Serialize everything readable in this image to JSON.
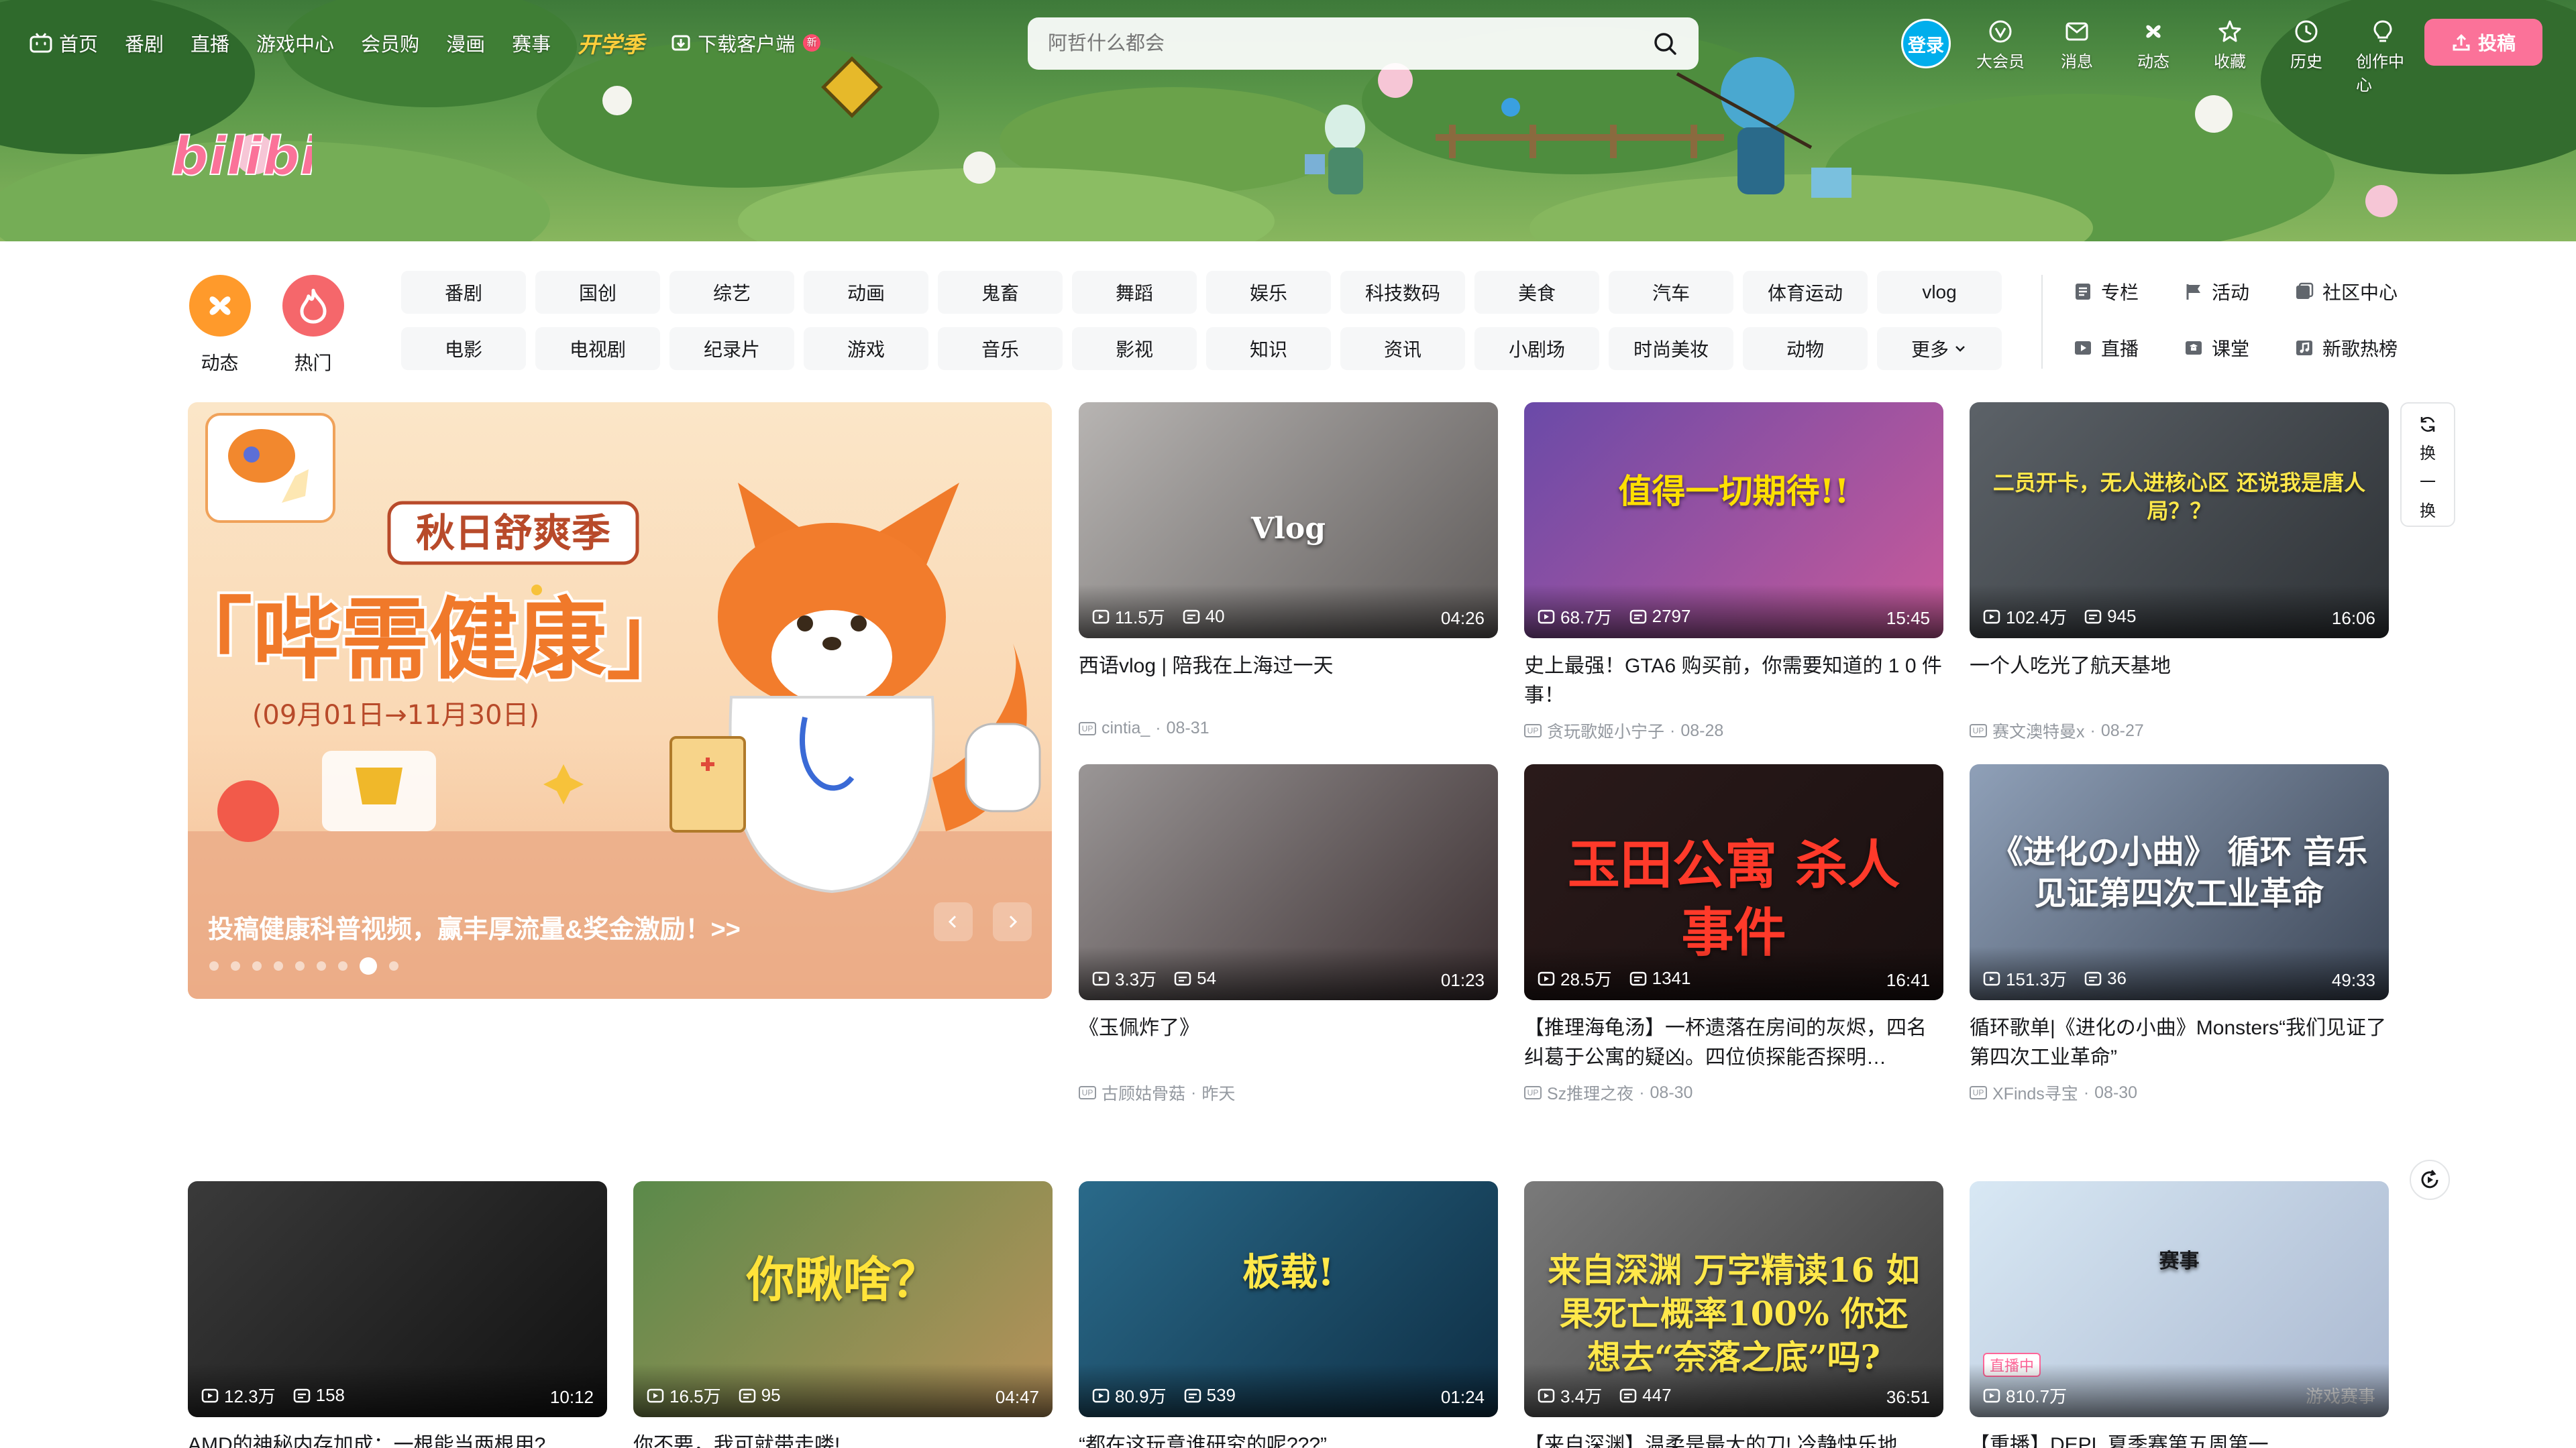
{
  "nav": {
    "left": [
      {
        "label": "首页",
        "icon": "tv-icon"
      },
      {
        "label": "番剧"
      },
      {
        "label": "直播"
      },
      {
        "label": "游戏中心"
      },
      {
        "label": "会员购"
      },
      {
        "label": "漫画"
      },
      {
        "label": "赛事"
      },
      {
        "label": "开学季",
        "special": true
      },
      {
        "label": "下载客户端",
        "icon": "download-icon",
        "badge": "新"
      }
    ],
    "search_placeholder": "阿哲什么都会",
    "login_label": "登录",
    "right": [
      {
        "label": "大会员",
        "icon": "vip-icon"
      },
      {
        "label": "消息",
        "icon": "message-icon"
      },
      {
        "label": "动态",
        "icon": "feed-icon"
      },
      {
        "label": "收藏",
        "icon": "star-icon"
      },
      {
        "label": "历史",
        "icon": "history-icon"
      },
      {
        "label": "创作中心",
        "icon": "bulb-icon"
      }
    ],
    "upload_label": "投稿"
  },
  "brand": {
    "logo_text": "bilibili",
    "accent": "#fb7299",
    "blue": "#00aeec"
  },
  "channels": {
    "main": [
      {
        "label": "动态",
        "color": "#ff9a2b"
      },
      {
        "label": "热门",
        "color": "#f5676b"
      }
    ],
    "row1": [
      "番剧",
      "国创",
      "综艺",
      "动画",
      "鬼畜",
      "舞蹈",
      "娱乐",
      "科技数码",
      "美食",
      "汽车",
      "体育运动",
      "vlog"
    ],
    "row2": [
      "电影",
      "电视剧",
      "纪录片",
      "游戏",
      "音乐",
      "影视",
      "知识",
      "资讯",
      "小剧场",
      "时尚美妆",
      "动物",
      "更多"
    ],
    "side": [
      {
        "label": "专栏",
        "icon": "column-icon"
      },
      {
        "label": "活动",
        "icon": "flag-icon"
      },
      {
        "label": "社区中心",
        "icon": "community-icon"
      },
      {
        "label": "直播",
        "icon": "live-icon"
      },
      {
        "label": "课堂",
        "icon": "classroom-icon"
      },
      {
        "label": "新歌热榜",
        "icon": "music-chart-icon"
      }
    ]
  },
  "carousel": {
    "tag": "秋日舒爽季",
    "headline": "「哔需健康」",
    "dates": "(09月01日→11月30日)",
    "caption": "投稿健康科普视频，赢丰厚流量&奖金激励！>>",
    "dot_count": 9,
    "active_dot": 7
  },
  "refresh_label": [
    "换",
    "一",
    "换"
  ],
  "cards": [
    {
      "views": "11.5万",
      "danmaku": "40",
      "duration": "04:26",
      "title": "西语vlog | 陪我在上海过一天",
      "uploader": "cintia_",
      "date": "08-31",
      "overlay": "Vlog",
      "bg": [
        "#b7b4b2",
        "#5e5a59"
      ]
    },
    {
      "views": "68.7万",
      "danmaku": "2797",
      "duration": "15:45",
      "title": "史上最强！GTA6 购买前，你需要知道的 1 0 件事！",
      "uploader": "贪玩歌姬小宁子",
      "date": "08-28",
      "overlay": "值得一切期待!!",
      "bg": [
        "#6a4aa8",
        "#c85a9a"
      ]
    },
    {
      "views": "102.4万",
      "danmaku": "945",
      "duration": "16:06",
      "title": "一个人吃光了航天基地",
      "uploader": "赛文澳特曼x",
      "date": "08-27",
      "overlay": "二员开卡，无人进核心区 还说我是唐人局？？",
      "bg": [
        "#5c6268",
        "#2e3236"
      ]
    },
    {
      "views": "3.3万",
      "danmaku": "54",
      "duration": "01:23",
      "title": "《玉佩炸了》",
      "uploader": "古顾姑骨菇",
      "date": "昨天",
      "overlay": "",
      "bg": [
        "#9a9696",
        "#3a2e30"
      ]
    },
    {
      "views": "28.5万",
      "danmaku": "1341",
      "duration": "16:41",
      "title": "【推理海龟汤】一杯遗落在房间的灰烬，四名纠葛于公寓的疑凶。四位侦探能否探明…",
      "uploader": "Sz推理之夜",
      "date": "08-30",
      "overlay": "玉田公寓 杀人事件",
      "bg": [
        "#2a1a1a",
        "#1a1010"
      ]
    },
    {
      "views": "151.3万",
      "danmaku": "36",
      "duration": "49:33",
      "title": "循环歌单|《进化の小曲》Monsters“我们见证了第四次工业革命”",
      "uploader": "XFinds寻宝",
      "date": "08-30",
      "overlay": "《进化の小曲》 循环 音乐 见证第四次工业革命",
      "bg": [
        "#8fa0b8",
        "#3c4656"
      ]
    },
    {
      "views": "12.3万",
      "danmaku": "158",
      "duration": "10:12",
      "title": "AMD的神秘内存加成：一根能当两根用?",
      "uploader": "",
      "date": "",
      "overlay": "",
      "bg": [
        "#3a3a3a",
        "#111111"
      ]
    },
    {
      "views": "16.5万",
      "danmaku": "95",
      "duration": "04:47",
      "title": "你不要，我可就带走喽!",
      "uploader": "",
      "date": "",
      "overlay": "你瞅啥？",
      "bg": [
        "#5a8a4a",
        "#b8925a"
      ]
    },
    {
      "views": "80.9万",
      "danmaku": "539",
      "duration": "01:24",
      "title": "“都在这玩意谁研究的呢???”",
      "uploader": "",
      "date": "",
      "overlay": "板载!",
      "bg": [
        "#2a6a8a",
        "#0e2e44"
      ]
    },
    {
      "views": "3.4万",
      "danmaku": "447",
      "duration": "36:51",
      "title": "【来自深渊】温柔是最大的刀! 冷静快乐地",
      "uploader": "",
      "date": "",
      "overlay": "来自深渊 万字精读16 如果死亡概率100% 你还想去“奈落之底”吗?",
      "bg": [
        "#7a7a7a",
        "#3a3a3a"
      ]
    },
    {
      "views": "810.7万",
      "danmaku": "",
      "duration": "",
      "title": "【重播】DEPL 夏季赛第五周第一",
      "uploader": "",
      "date": "",
      "overlay": "赛事",
      "tag": "直播中",
      "corner": "游戏赛事",
      "bg": [
        "#d8e8f4",
        "#aab8d0"
      ]
    }
  ]
}
